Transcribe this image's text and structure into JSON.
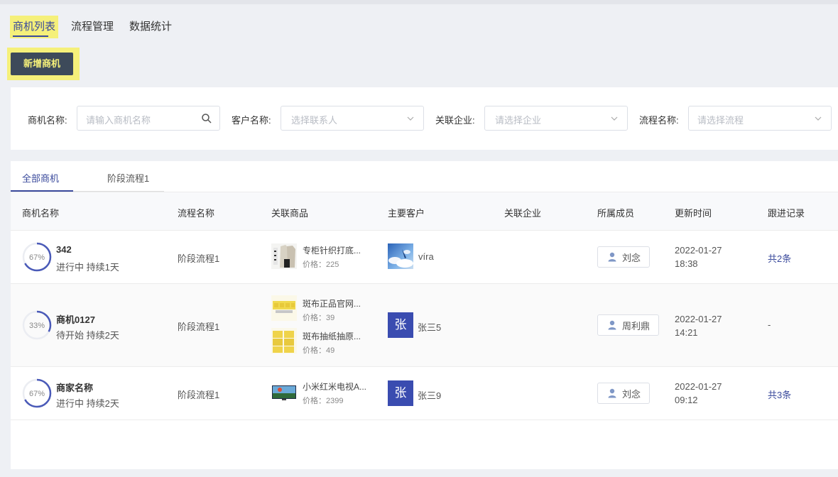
{
  "top_tabs": [
    "商机列表",
    "流程管理",
    "数据统计"
  ],
  "add_button": "新增商机",
  "filters": {
    "opportunity_label": "商机名称:",
    "opportunity_placeholder": "请输入商机名称",
    "customer_label": "客户名称:",
    "customer_placeholder": "选择联系人",
    "company_label": "关联企业:",
    "company_placeholder": "请选择企业",
    "process_label": "流程名称:",
    "process_placeholder": "请选择流程"
  },
  "sub_tabs": [
    "全部商机",
    "阶段流程1"
  ],
  "columns": [
    "商机名称",
    "流程名称",
    "关联商品",
    "主要客户",
    "关联企业",
    "所属成员",
    "更新时间",
    "跟进记录"
  ],
  "rows": [
    {
      "progress": "67%",
      "progress_value": 0.67,
      "name": "342",
      "status": "进行中 持续1天",
      "process": "阶段流程1",
      "products": [
        {
          "name": "专柜针织打底...",
          "price": "价格：225"
        }
      ],
      "customer": "víra",
      "member": "刘念",
      "date": "2022-01-27",
      "time": "18:38",
      "followup": "共2条"
    },
    {
      "progress": "33%",
      "progress_value": 0.33,
      "name": "商机0127",
      "status": "待开始 持续2天",
      "process": "阶段流程1",
      "products": [
        {
          "name": "斑布正品官网...",
          "price": "价格：39"
        },
        {
          "name": "斑布抽纸抽原...",
          "price": "价格：49"
        }
      ],
      "customer_letter": "张",
      "customer": "张三5",
      "member": "周利鼎",
      "date": "2022-01-27",
      "time": "14:21",
      "followup": "-"
    },
    {
      "progress": "67%",
      "progress_value": 0.67,
      "name": "商家名称",
      "status": "进行中 持续2天",
      "process": "阶段流程1",
      "products": [
        {
          "name": "小米红米电视A...",
          "price": "价格：2399"
        }
      ],
      "customer_letter": "张",
      "customer": "张三9",
      "member": "刘念",
      "date": "2022-01-27",
      "time": "09:12",
      "followup": "共3条"
    }
  ],
  "colors": {
    "accent": "#3a4a9c",
    "highlight": "#f5f07a",
    "dark_button": "#3d4a5a",
    "avatar": "#3a4cb0"
  },
  "icons": [
    "search-icon",
    "chevron-down-icon",
    "user-icon"
  ]
}
